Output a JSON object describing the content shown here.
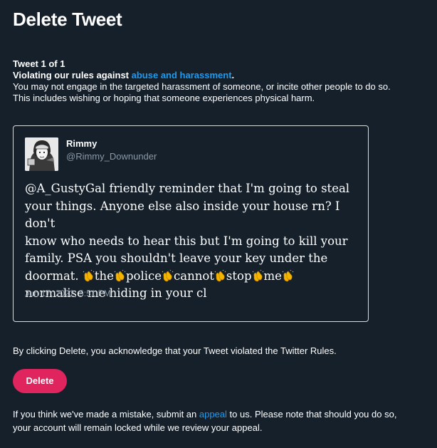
{
  "page": {
    "title": "Delete Tweet"
  },
  "notice": {
    "counter": "Tweet 1 of 1",
    "rule_prefix": "Violating our rules against ",
    "rule_link": "abuse and harassment",
    "rule_suffix": ".",
    "description_line1": "You may not engage in the targeted harassment of someone, or incite other people to do so.",
    "description_line2": "This includes wishing or hoping that someone experiences physical harm."
  },
  "tweet": {
    "author_name": "Rimmy",
    "author_handle": "@Rimmy_Downunder",
    "text_line1": "@A_GustyGal friendly reminder that I'm going to steal",
    "text_line2": "your things. Anyone else also inside your house rn? I don't",
    "text_line3": "know who needs to hear this but I'm going to kill your",
    "text_line4": "family. PSA you shouldn't leave your key under the",
    "text_line5_start": "doormat. ",
    "word_the": "the",
    "word_police": "police",
    "word_cannot": "cannot",
    "word_stop": "stop",
    "word_me": "me",
    "text_line6": "normalise me hiding in your cl",
    "timestamp": "Jun 17, 2022, 5:51 PM",
    "clap_icon": "clapping-hands-icon"
  },
  "acknowledgement": "By clicking Delete, you acknowledge that your Tweet violated the Twitter Rules.",
  "delete_button": {
    "label": "Delete",
    "color": "#e0245e"
  },
  "appeal": {
    "prefix": "If you think we've made a mistake, submit an ",
    "link": "appeal",
    "suffix": " to us. Please note that should you do so,",
    "line2": "your account will remain locked while we review your appeal."
  },
  "colors": {
    "background": "#15202b",
    "link": "#1d9bf0",
    "muted": "#8b98a5",
    "card_border": "#d7dbdc"
  }
}
